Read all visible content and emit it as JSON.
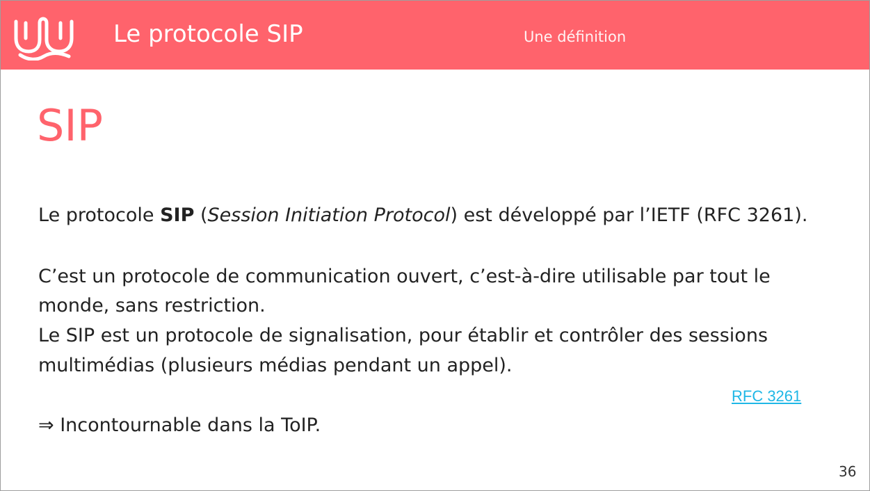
{
  "header": {
    "title": "Le protocole SIP",
    "subtitle": "Une définition",
    "logo_icon": "wave-hands-logo-icon",
    "color": "#ff636c"
  },
  "slide": {
    "title": "SIP",
    "paragraph1": {
      "prefix": "Le protocole ",
      "bold": "SIP",
      "paren_open": " (",
      "italic": "Session Initiation Protocol",
      "suffix": ") est développé par l’IETF (RFC 3261)."
    },
    "line2": "C’est un protocole de communication ouvert, c’est-à-dire utilisable par tout le",
    "line3": "monde, sans restriction.",
    "line4": "Le SIP est un protocole de signalisation, pour établir et contrôler des sessions",
    "line5": "multimédias (plusieurs médias pendant un appel).",
    "link": "RFC 3261",
    "conclusion": "⇒ Incontournable dans la ToIP.",
    "page_number": "36"
  },
  "colors": {
    "accent": "#ff636c",
    "link": "#1fb7e6",
    "text": "#222222"
  }
}
